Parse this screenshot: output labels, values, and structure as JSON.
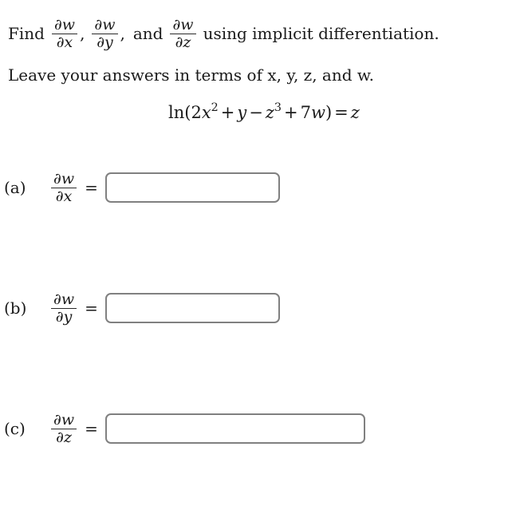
{
  "problem": {
    "instruction_prefix": "Find",
    "instruction_derivative_1_num": "∂w",
    "instruction_derivative_1_den": "∂x",
    "comma_1": ",",
    "instruction_derivative_2_num": "∂w",
    "instruction_derivative_2_den": "∂y",
    "comma_2": ",",
    "conjunction": "and",
    "instruction_derivative_3_num": "∂w",
    "instruction_derivative_3_den": "∂z",
    "instruction_suffix": "using implicit differentiation.",
    "secondary_instruction": "Leave your answers in terms of x, y, z, and w.",
    "equation": {
      "ln": "ln",
      "open_paren": "(",
      "coefficient_2": "2",
      "var_x": "x",
      "exponent_2": "2",
      "plus_1": "+",
      "var_y": "y",
      "minus": "−",
      "var_z": "z",
      "exponent_3": "3",
      "plus_2": "+",
      "coefficient_7": "7",
      "var_w": "w",
      "close_paren": ")",
      "equals": "=",
      "rhs": "z",
      "plain": "ln(2x² + y − z³ + 7w) = z"
    }
  },
  "parts": [
    {
      "label": "(a)",
      "numerator": "∂w",
      "denominator": "∂x",
      "equals": "=",
      "answer_value": "",
      "answer_placeholder": ""
    },
    {
      "label": "(b)",
      "numerator": "∂w",
      "denominator": "∂y",
      "equals": "=",
      "answer_value": "",
      "answer_placeholder": ""
    },
    {
      "label": "(c)",
      "numerator": "∂w",
      "denominator": "∂z",
      "equals": "=",
      "answer_value": "",
      "answer_placeholder": ""
    }
  ],
  "colors": {
    "background": "#ffffff",
    "text": "#1a1a1a",
    "input_border": "#808080"
  }
}
